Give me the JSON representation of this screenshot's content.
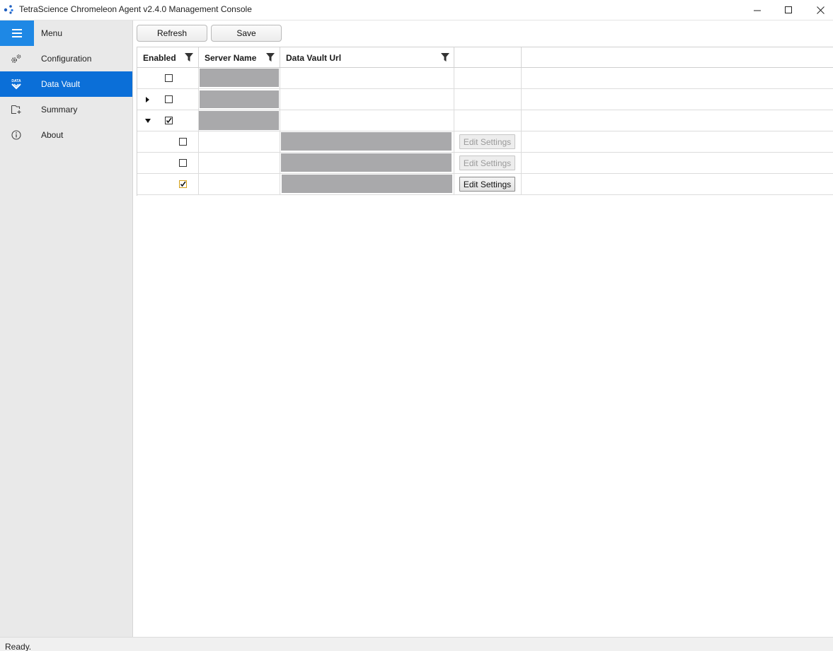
{
  "window": {
    "title": "TetraScience Chromeleon Agent v2.4.0 Management Console",
    "app_icon": "tetrascience-logo-icon",
    "controls": [
      "minimize-icon",
      "maximize-icon",
      "close-icon"
    ]
  },
  "sidebar": {
    "menu_label": "Menu",
    "menu_icon": "hamburger-icon",
    "items": [
      {
        "label": "Configuration",
        "icon": "gears-icon",
        "active": false
      },
      {
        "label": "Data Vault",
        "icon": "data-vault-icon",
        "active": true
      },
      {
        "label": "Summary",
        "icon": "summary-icon",
        "active": false
      },
      {
        "label": "About",
        "icon": "info-icon",
        "active": false
      }
    ]
  },
  "toolbar": {
    "refresh_label": "Refresh",
    "save_label": "Save"
  },
  "grid": {
    "columns": [
      {
        "label": "Enabled",
        "filter_icon": "filter-icon"
      },
      {
        "label": "Server Name",
        "filter_icon": "filter-icon"
      },
      {
        "label": "Data Vault Url",
        "filter_icon": "filter-icon"
      },
      {
        "label": ""
      }
    ],
    "server_rows": [
      {
        "expander": "none",
        "enabled": false,
        "server_name": "[redacted]"
      },
      {
        "expander": "collapsed",
        "enabled": false,
        "server_name": "[redacted]"
      },
      {
        "expander": "expanded",
        "enabled": true,
        "server_name": "[redacted]"
      }
    ],
    "vault_rows": [
      {
        "enabled": false,
        "url": "[redacted]",
        "edit_label": "Edit Settings",
        "edit_enabled": false
      },
      {
        "enabled": false,
        "url": "[redacted]",
        "edit_label": "Edit Settings",
        "edit_enabled": false
      },
      {
        "enabled": true,
        "url": "[redacted]",
        "edit_label": "Edit Settings",
        "edit_enabled": true
      }
    ]
  },
  "colors": {
    "accent": "#1e88e5",
    "active_nav": "#0b6fd8",
    "sidebar_bg": "#e9e9e9",
    "redaction": "#a9a9ab"
  },
  "status": {
    "text": "Ready."
  }
}
